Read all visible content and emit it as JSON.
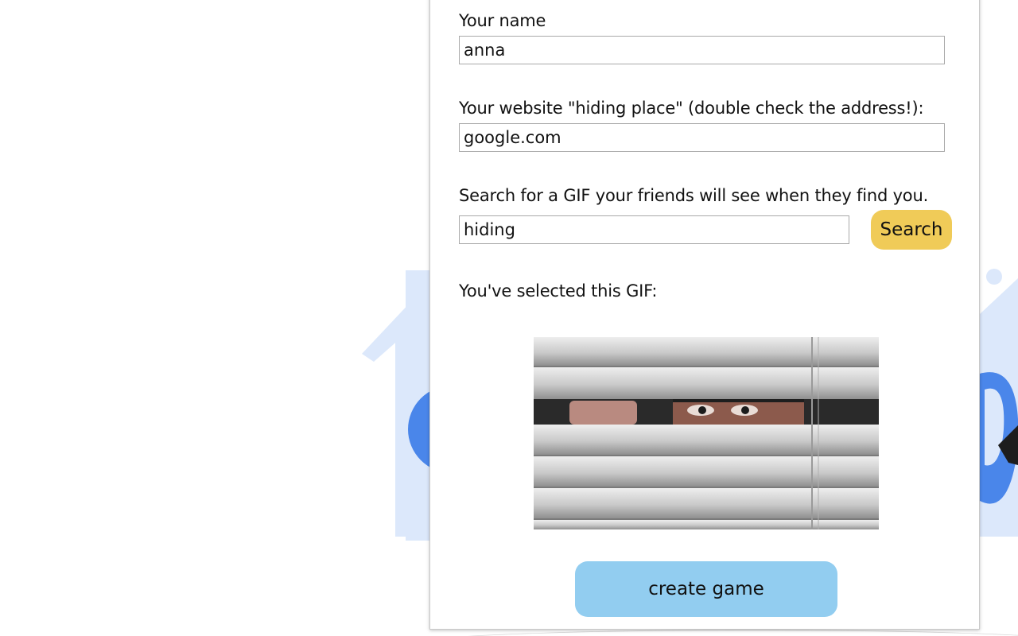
{
  "form": {
    "name_label": "Your name",
    "name_value": "anna",
    "website_label": "Your website \"hiding place\" (double check the address!):",
    "website_value": "google.com",
    "gif_search_label": "Search for a GIF your friends will see when they find you.",
    "gif_search_value": "hiding",
    "search_button_label": "Search",
    "selected_gif_label": "You've selected this GIF:",
    "create_button_label": "create game"
  },
  "colors": {
    "search_button": "#f0cb58",
    "create_button": "#92cdf0",
    "background_illustration": "#dce8fb",
    "illustration_blue": "#4a86ea"
  },
  "icons": {
    "background": "house-illustration",
    "gif": "eyes-peeking-through-blinds-image"
  }
}
